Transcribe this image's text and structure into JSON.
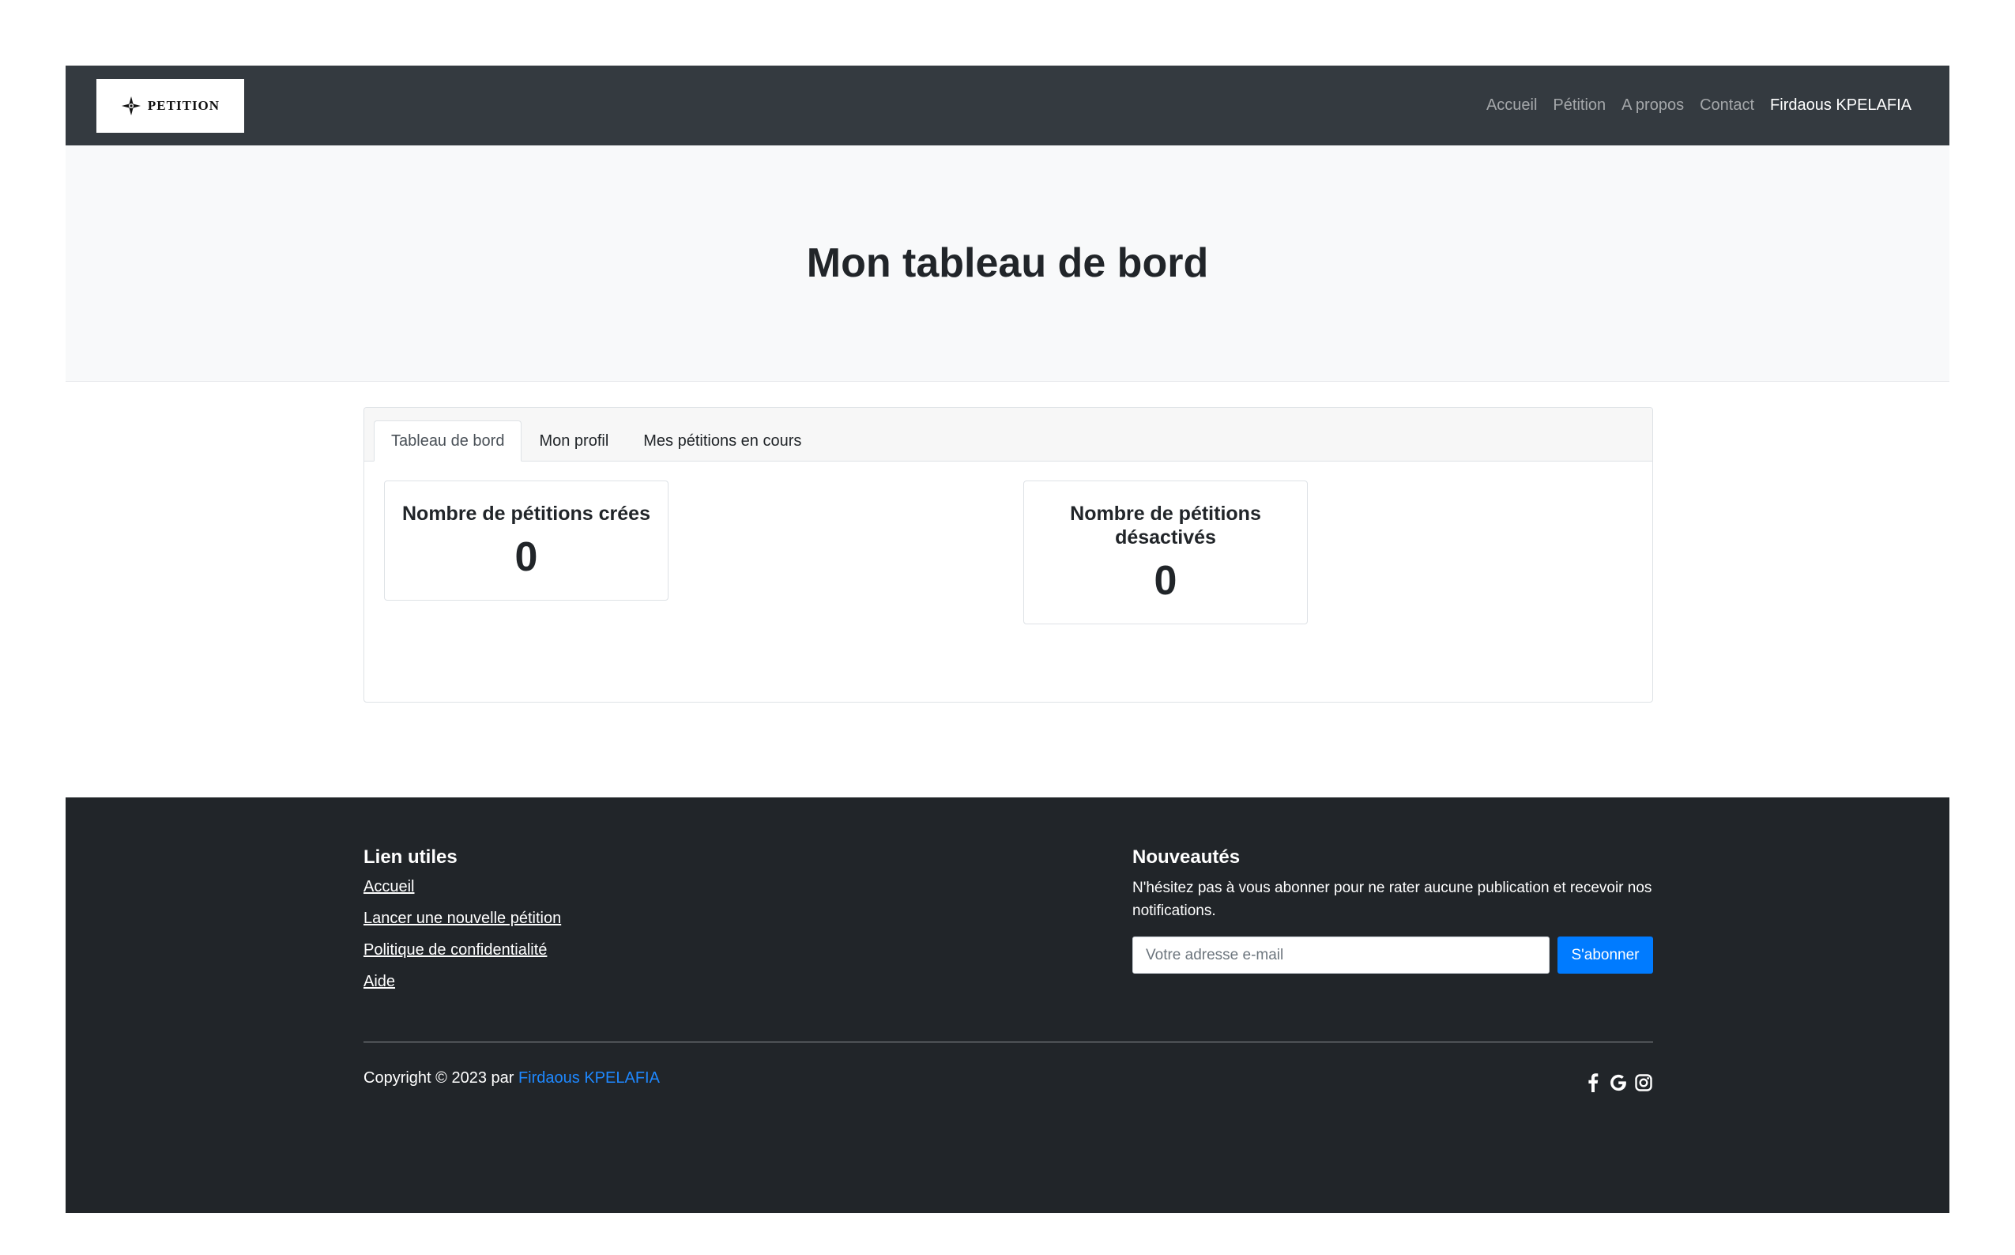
{
  "navbar": {
    "logo_text": "PETITION",
    "links": [
      {
        "label": "Accueil"
      },
      {
        "label": "Pétition"
      },
      {
        "label": "A propos"
      },
      {
        "label": "Contact"
      }
    ],
    "user_name": "Firdaous KPELAFIA"
  },
  "hero": {
    "title": "Mon tableau de bord"
  },
  "tabs": [
    {
      "label": "Tableau de bord",
      "active": true
    },
    {
      "label": "Mon profil",
      "active": false
    },
    {
      "label": "Mes pétitions en cours",
      "active": false
    }
  ],
  "stats": [
    {
      "title": "Nombre de pétitions crées",
      "value": "0"
    },
    {
      "title": "Nombre de pétitions désactivés",
      "value": "0"
    }
  ],
  "footer": {
    "links_title": "Lien utiles",
    "links": [
      {
        "label": "Accueil"
      },
      {
        "label": "Lancer une nouvelle pétition"
      },
      {
        "label": "Politique de confidentialité"
      },
      {
        "label": "Aide"
      }
    ],
    "news_title": "Nouveautés",
    "news_text": "N'hésitez pas à vous abonner pour ne rater aucune publication et recevoir nos notifications.",
    "email_placeholder": "Votre adresse e-mail",
    "subscribe_label": "S'abonner",
    "copyright_prefix": "Copyright © 2023 par",
    "copyright_author": "Firdaous KPELAFIA",
    "socials": [
      "facebook-icon",
      "google-icon",
      "instagram-icon"
    ]
  },
  "colors": {
    "navbar_bg": "#343a40",
    "hero_bg": "#f8f9fa",
    "footer_bg": "#212529",
    "accent": "#007bff"
  }
}
